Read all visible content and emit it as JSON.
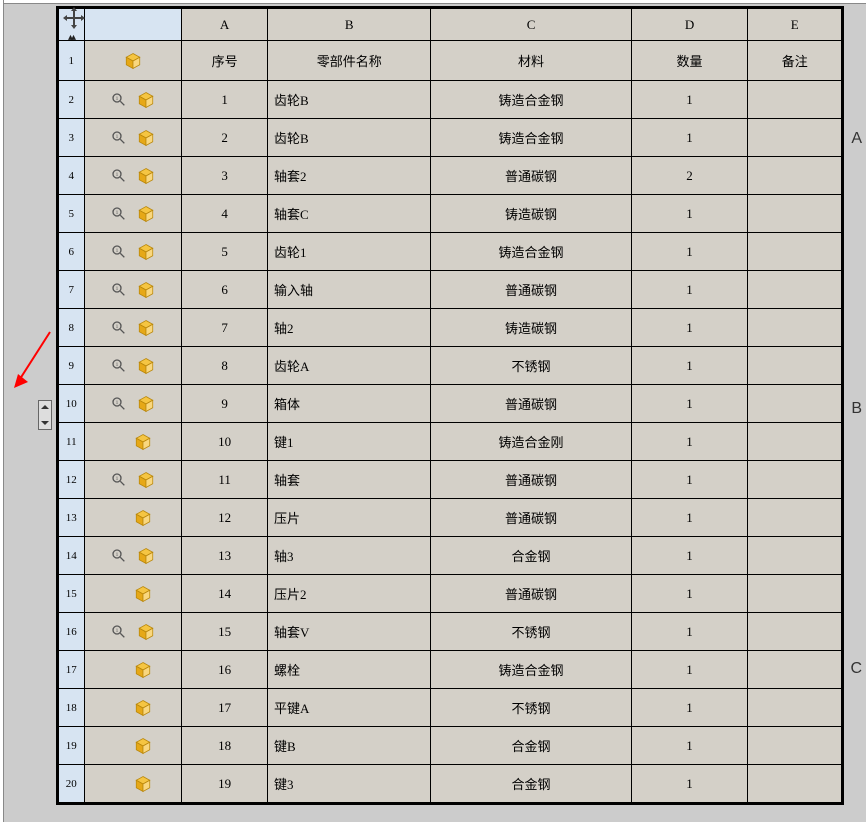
{
  "columns": {
    "letters": [
      "A",
      "B",
      "C",
      "D",
      "E"
    ],
    "headers": [
      "序号",
      "零部件名称",
      "材料",
      "数量",
      "备注"
    ]
  },
  "right_labels": [
    "A",
    "B",
    "C"
  ],
  "rows": [
    {
      "idx": "1",
      "mag": false,
      "seq": "",
      "name": "",
      "material": "",
      "qty": "",
      "note": ""
    },
    {
      "idx": "2",
      "mag": true,
      "seq": "1",
      "name": "齿轮B",
      "material": "铸造合金钢",
      "qty": "1",
      "note": ""
    },
    {
      "idx": "3",
      "mag": true,
      "seq": "2",
      "name": "齿轮B",
      "material": "铸造合金钢",
      "qty": "1",
      "note": ""
    },
    {
      "idx": "4",
      "mag": true,
      "seq": "3",
      "name": "轴套2",
      "material": "普通碳钢",
      "qty": "2",
      "note": ""
    },
    {
      "idx": "5",
      "mag": true,
      "seq": "4",
      "name": "轴套C",
      "material": "铸造碳钢",
      "qty": "1",
      "note": ""
    },
    {
      "idx": "6",
      "mag": true,
      "seq": "5",
      "name": "齿轮1",
      "material": "铸造合金钢",
      "qty": "1",
      "note": ""
    },
    {
      "idx": "7",
      "mag": true,
      "seq": "6",
      "name": "输入轴",
      "material": "普通碳钢",
      "qty": "1",
      "note": ""
    },
    {
      "idx": "8",
      "mag": true,
      "seq": "7",
      "name": "轴2",
      "material": "铸造碳钢",
      "qty": "1",
      "note": ""
    },
    {
      "idx": "9",
      "mag": true,
      "seq": "8",
      "name": "齿轮A",
      "material": "不锈钢",
      "qty": "1",
      "note": ""
    },
    {
      "idx": "10",
      "mag": true,
      "seq": "9",
      "name": "箱体",
      "material": "普通碳钢",
      "qty": "1",
      "note": ""
    },
    {
      "idx": "11",
      "mag": false,
      "seq": "10",
      "name": "键1",
      "material": "铸造合金刚",
      "qty": "1",
      "note": ""
    },
    {
      "idx": "12",
      "mag": true,
      "seq": "11",
      "name": "轴套",
      "material": "普通碳钢",
      "qty": "1",
      "note": ""
    },
    {
      "idx": "13",
      "mag": false,
      "seq": "12",
      "name": "压片",
      "material": "普通碳钢",
      "qty": "1",
      "note": ""
    },
    {
      "idx": "14",
      "mag": true,
      "seq": "13",
      "name": "轴3",
      "material": "合金钢",
      "qty": "1",
      "note": ""
    },
    {
      "idx": "15",
      "mag": false,
      "seq": "14",
      "name": "压片2",
      "material": "普通碳钢",
      "qty": "1",
      "note": ""
    },
    {
      "idx": "16",
      "mag": true,
      "seq": "15",
      "name": "轴套V",
      "material": "不锈钢",
      "qty": "1",
      "note": ""
    },
    {
      "idx": "17",
      "mag": false,
      "seq": "16",
      "name": "螺栓",
      "material": "铸造合金钢",
      "qty": "1",
      "note": ""
    },
    {
      "idx": "18",
      "mag": false,
      "seq": "17",
      "name": "平键A",
      "material": "不锈钢",
      "qty": "1",
      "note": ""
    },
    {
      "idx": "19",
      "mag": false,
      "seq": "18",
      "name": "键B",
      "material": "合金钢",
      "qty": "1",
      "note": ""
    },
    {
      "idx": "20",
      "mag": false,
      "seq": "19",
      "name": "键3",
      "material": "合金钢",
      "qty": "1",
      "note": ""
    }
  ]
}
